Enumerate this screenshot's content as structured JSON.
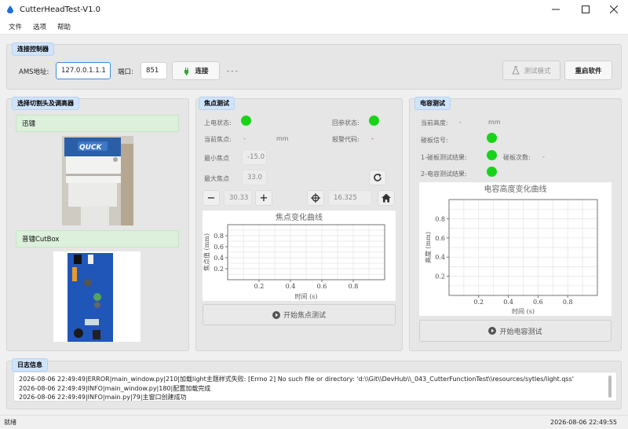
{
  "window": {
    "title": "CutterHeadTest-V1.0"
  },
  "menu": [
    "文件",
    "选项",
    "帮助"
  ],
  "connection": {
    "section_title": "连接控制器",
    "ams_label": "AMS地址:",
    "ams_value": "127.0.0.1.1.1",
    "port_label": "端口:",
    "port_value": "851",
    "connect_label": "连接",
    "status_text": "- - -",
    "test_mode_label": "测试模式",
    "restart_label": "重启软件"
  },
  "selector": {
    "section_title": "选择切割头及调高器",
    "head_name": "迅镭",
    "controller_name": "普镭CutBox"
  },
  "focus": {
    "section_title": "焦点测试",
    "power_label": "上电状态:",
    "home_label": "回参状态:",
    "current_label": "当前焦点:",
    "current_value": "-",
    "current_unit": "mm",
    "alarm_label": "报警代码:",
    "alarm_value": "-",
    "min_label": "最小焦点",
    "min_value": "-15.0",
    "max_label": "最大焦点",
    "max_value": "33.0",
    "step_value": "30.33",
    "target_value": "16.325",
    "start_label": "开始焦点测试",
    "status_color": "#19d319"
  },
  "capacitance": {
    "section_title": "电容测试",
    "height_label": "当前高度:",
    "height_value": "-",
    "height_unit": "mm",
    "touch_signal_label": "碰板信号:",
    "touch1_label": "1-碰板测试结果:",
    "touch_count_label": "碰板次数:",
    "touch_count_value": "-",
    "cap2_label": "2-电容测试结果:",
    "start_label": "开始电容测试"
  },
  "chart_data": [
    {
      "type": "line",
      "title": "焦点变化曲线",
      "xlabel": "时间 (s)",
      "ylabel": "焦点值 (mm)",
      "xlim": [
        0,
        1
      ],
      "ylim": [
        0,
        1
      ],
      "xticks": [
        "0.2",
        "0.4",
        "0.6",
        "0.8"
      ],
      "yticks": [
        "0.2",
        "0.4",
        "0.6",
        "0.8"
      ],
      "series": [],
      "grid": true
    },
    {
      "type": "line",
      "title": "电容高度变化曲线",
      "xlabel": "时间 (s)",
      "ylabel": "高度 (mm)",
      "xlim": [
        0,
        1
      ],
      "ylim": [
        0,
        1
      ],
      "xticks": [
        "0.2",
        "0.4",
        "0.6",
        "0.8"
      ],
      "yticks": [
        "0.2",
        "0.4",
        "0.6",
        "0.8"
      ],
      "series": [],
      "grid": true
    }
  ],
  "log": {
    "section_title": "日志信息",
    "lines": [
      "2026-08-06 22:49:49|ERROR|main_window.py|210|加载light主题样式失败: [Errno 2] No such file or directory: 'd:\\\\Git\\\\DevHub\\\\_043_CutterFunctionTest\\\\resources/sytles/light.qss'",
      "2026-08-06 22:49:49|INFO|main_window.py|180|配置加载完成",
      "2026-08-06 22:49:49|INFO|main.py|79|主窗口创建成功"
    ]
  },
  "statusbar": {
    "left": "就绪",
    "right": "2026-08-06 22:49:55"
  }
}
